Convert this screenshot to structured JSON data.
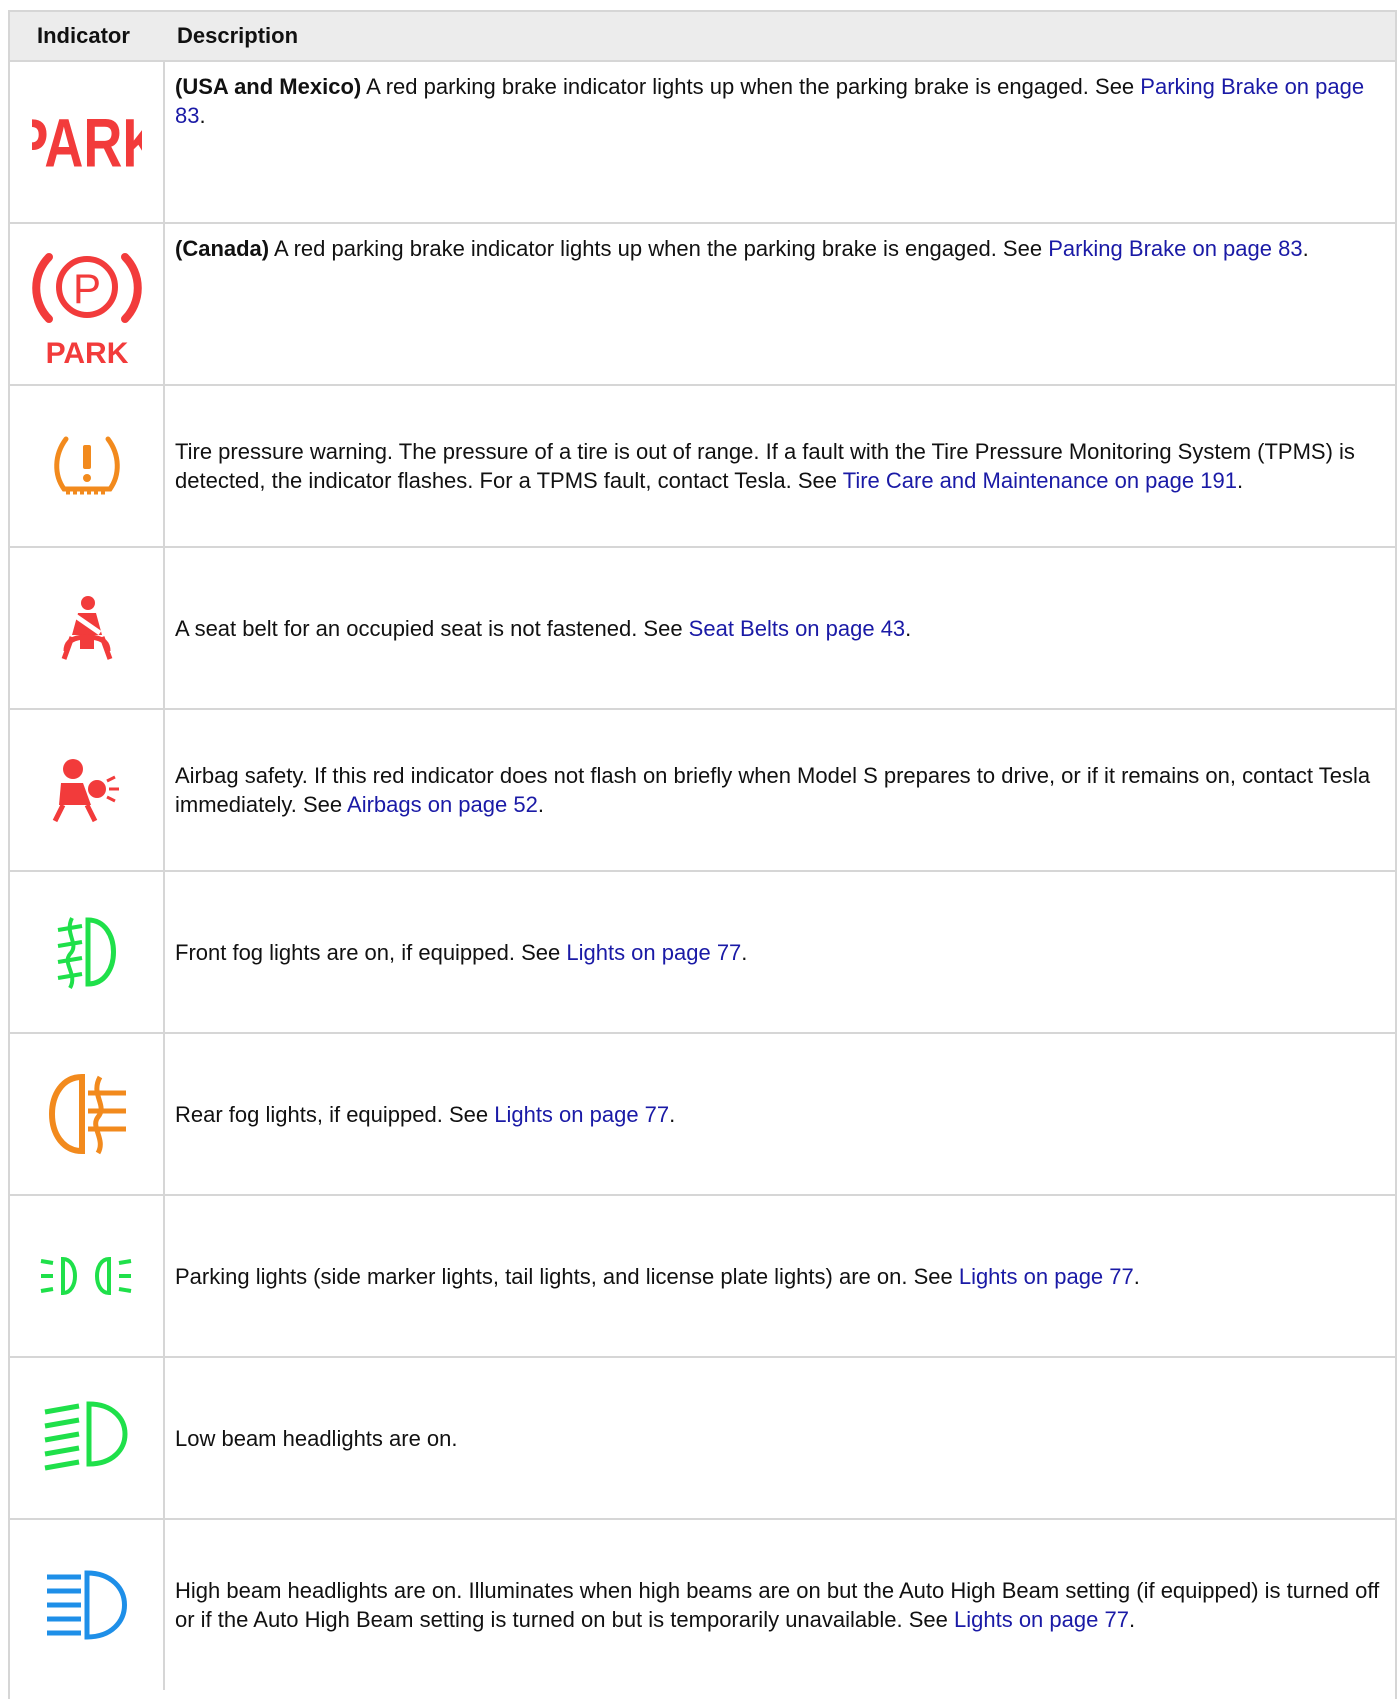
{
  "header": {
    "indicator": "Indicator",
    "description": "Description"
  },
  "colors": {
    "red": "#f23b3b",
    "orange": "#f28a1d",
    "green": "#1fe04a",
    "blue": "#1e8fe8",
    "link": "#1a1aa6"
  },
  "rows": [
    {
      "icon": "park-text-icon",
      "icon_text": "PARK",
      "bold": "(USA and Mexico)",
      "text": " A red parking brake indicator lights up when the parking brake is engaged. See ",
      "link": "Parking Brake on page 83",
      "after": "."
    },
    {
      "icon": "parking-brake-circle-icon",
      "icon_text": "PARK",
      "bold": "(Canada)",
      "text": " A red parking brake indicator lights up when the parking brake is engaged. See ",
      "link": "Parking Brake on page 83",
      "after": "."
    },
    {
      "icon": "tire-pressure-icon",
      "bold": "",
      "text": "Tire pressure warning. The pressure of a tire is out of range. If a fault with the Tire Pressure Monitoring System (TPMS) is detected, the indicator flashes. For a TPMS fault, contact Tesla. See ",
      "link": "Tire Care and Maintenance on page 191",
      "after": "."
    },
    {
      "icon": "seat-belt-icon",
      "bold": "",
      "text": "A seat belt for an occupied seat is not fastened. See ",
      "link": "Seat Belts on page 43",
      "after": "."
    },
    {
      "icon": "airbag-icon",
      "bold": "",
      "text": "Airbag safety. If this red indicator does not flash on briefly when Model S prepares to drive, or if it remains on, contact Tesla immediately. See ",
      "link": "Airbags on page 52",
      "after": "."
    },
    {
      "icon": "front-fog-light-icon",
      "bold": "",
      "text": "Front fog lights are on, if equipped. See ",
      "link": "Lights on page 77",
      "after": "."
    },
    {
      "icon": "rear-fog-light-icon",
      "bold": "",
      "text": "Rear fog lights, if equipped. See ",
      "link": "Lights on page 77",
      "after": "."
    },
    {
      "icon": "parking-lights-icon",
      "bold": "",
      "text": "Parking lights (side marker lights, tail lights, and license plate lights) are on. See ",
      "link": "Lights on page 77",
      "after": "."
    },
    {
      "icon": "low-beam-icon",
      "bold": "",
      "text": "Low beam headlights are on.",
      "link": "",
      "after": ""
    },
    {
      "icon": "high-beam-icon",
      "bold": "",
      "text": "High beam headlights are on. Illuminates when high beams are on but the Auto High Beam setting (if equipped) is turned off or if the Auto High Beam setting is turned on but is temporarily unavailable. See ",
      "link": "Lights on page 77",
      "after": "."
    }
  ]
}
